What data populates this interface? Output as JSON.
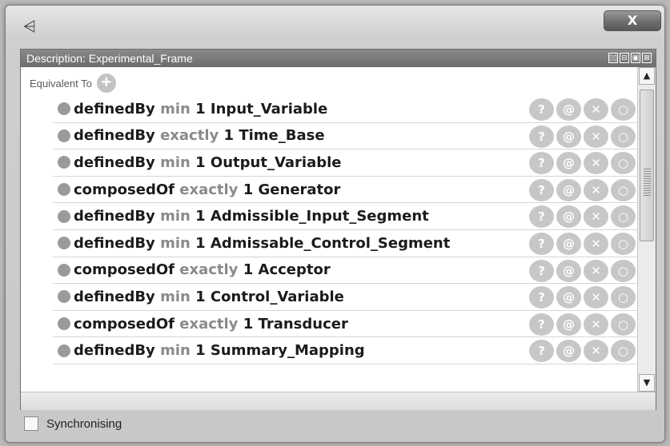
{
  "window": {
    "app_icon": "protege-icon",
    "close_label": "X"
  },
  "panel": {
    "title": "Description: Experimental_Frame",
    "controls": [
      "▯▯",
      "⊟",
      "▣",
      "⊠"
    ]
  },
  "equivalent": {
    "label": "Equivalent To",
    "add_label": "+"
  },
  "rows": [
    {
      "property": "definedBy",
      "quantifier": "min",
      "cardinality": "1",
      "class": "Input_Variable"
    },
    {
      "property": "definedBy",
      "quantifier": "exactly",
      "cardinality": "1",
      "class": "Time_Base"
    },
    {
      "property": "definedBy",
      "quantifier": "min",
      "cardinality": "1",
      "class": "Output_Variable"
    },
    {
      "property": "composedOf",
      "quantifier": "exactly",
      "cardinality": "1",
      "class": "Generator"
    },
    {
      "property": "definedBy",
      "quantifier": "min",
      "cardinality": "1",
      "class": "Admissible_Input_Segment"
    },
    {
      "property": "definedBy",
      "quantifier": "min",
      "cardinality": "1",
      "class": "Admissable_Control_Segment"
    },
    {
      "property": "composedOf",
      "quantifier": "exactly",
      "cardinality": "1",
      "class": "Acceptor"
    },
    {
      "property": "definedBy",
      "quantifier": "min",
      "cardinality": "1",
      "class": "Control_Variable"
    },
    {
      "property": "composedOf",
      "quantifier": "exactly",
      "cardinality": "1",
      "class": "Transducer"
    },
    {
      "property": "definedBy",
      "quantifier": "min",
      "cardinality": "1",
      "class": "Summary_Mapping"
    }
  ],
  "row_actions": {
    "help": "?",
    "annotate": "@",
    "delete": "✕",
    "edit": "○"
  },
  "scrollbar": {
    "up": "▲",
    "down": "▼"
  },
  "footer": {
    "sync_label": "Synchronising",
    "sync_checked": false
  }
}
